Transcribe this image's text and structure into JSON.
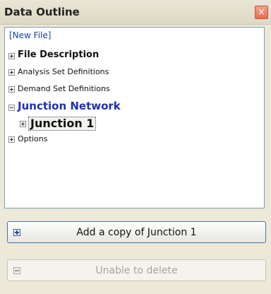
{
  "window": {
    "title": "Data Outline",
    "close_glyph": "×"
  },
  "tree": {
    "root_label": "[New File]",
    "items": [
      {
        "label": "File Description",
        "expander": "plus"
      },
      {
        "label": "Analysis Set Definitions",
        "expander": "plus"
      },
      {
        "label": "Demand Set Definitions",
        "expander": "plus"
      },
      {
        "label": "Junction Network",
        "expander": "minus"
      },
      {
        "label": "Junction 1",
        "expander": "plus",
        "selected": true
      },
      {
        "label": "Options",
        "expander": "plus"
      }
    ]
  },
  "buttons": {
    "add_copy": {
      "label": "Add a copy of Junction 1",
      "icon": "plus-box-icon"
    },
    "delete": {
      "label": "Unable to delete",
      "icon": "minus-box-icon",
      "enabled": false
    }
  },
  "colors": {
    "accent_blue": "#1f2fb5",
    "close_red": "#e86b4c"
  }
}
